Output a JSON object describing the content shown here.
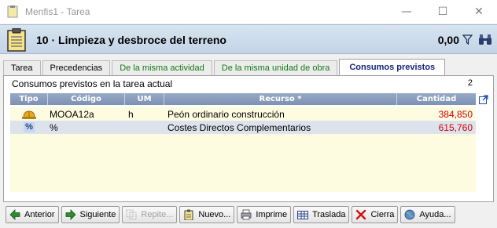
{
  "window": {
    "title": "Menfis1 - Tarea",
    "controls": {
      "minimize": "—",
      "maximize": "☐",
      "close": "✕"
    }
  },
  "header": {
    "task_title": "10 · Limpieza y desbroce del terreno",
    "value": "0,00"
  },
  "tabs": [
    {
      "label": "Tarea",
      "state": "normal"
    },
    {
      "label": "Precedencias",
      "state": "normal"
    },
    {
      "label": "De la misma actividad",
      "state": "green"
    },
    {
      "label": "De la misma unidad de obra",
      "state": "green"
    },
    {
      "label": "Consumos previstos",
      "state": "active"
    }
  ],
  "panel": {
    "caption": "Consumos previstos en la tarea actual",
    "count": "2"
  },
  "grid": {
    "columns": [
      "Tipo",
      "Código",
      "UM",
      "Recurso *",
      "Cantidad"
    ],
    "rows": [
      {
        "tipo_icon": "helmet-icon",
        "codigo": "MOOA12a",
        "um": "h",
        "recurso": "Peón ordinario construcción",
        "cantidad": "384,850"
      },
      {
        "tipo_icon": "percent-icon",
        "tipo_text": "%",
        "codigo": "%",
        "um": "",
        "recurso": "Costes Directos Complementarios",
        "cantidad": "615,760"
      }
    ]
  },
  "buttons": {
    "anterior": "Anterior",
    "siguiente": "Siguiente",
    "repite": "Repite...",
    "nuevo": "Nuevo...",
    "imprime": "Imprime",
    "traslada": "Traslada",
    "cierra": "Cierra",
    "ayuda": "Ayuda..."
  },
  "colors": {
    "header_band": "#c3d4e6",
    "grid_header": "#7d91b3",
    "grid_body": "#fdfbe0",
    "quantity_text": "#d40000",
    "active_tab_text": "#15267a",
    "green_tab_text": "#127a12"
  }
}
